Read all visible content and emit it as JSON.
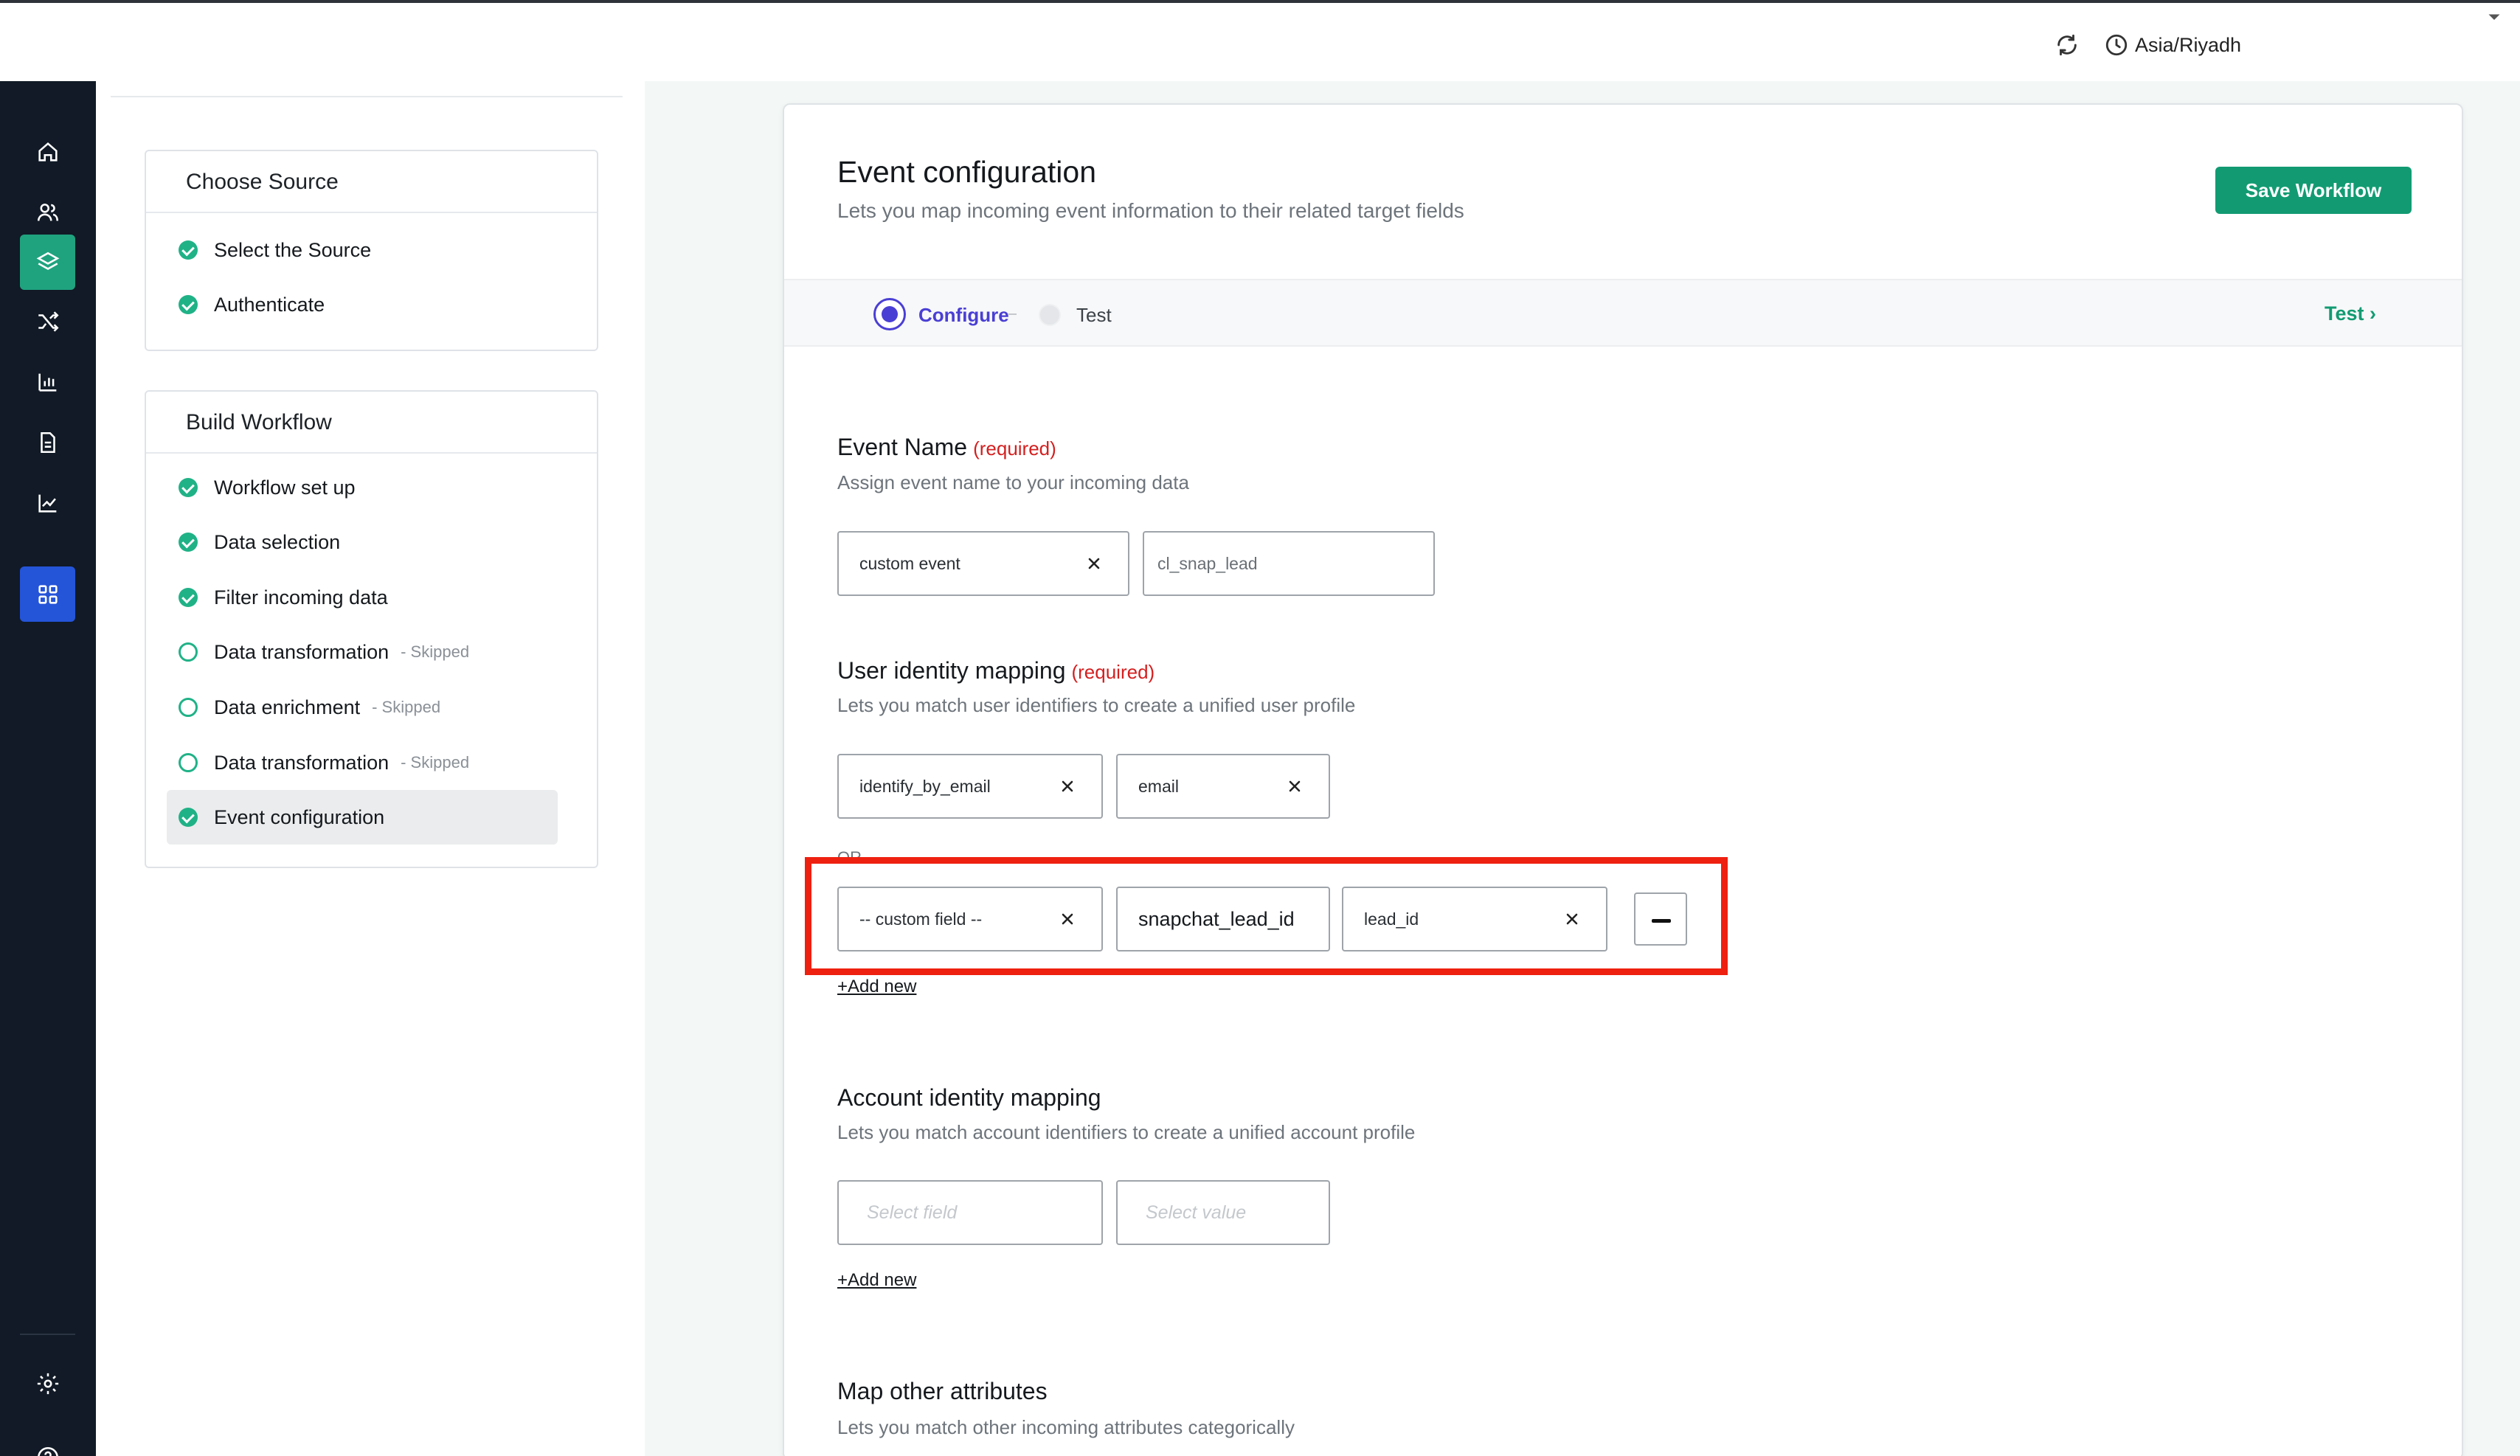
{
  "header": {
    "timezone": "Asia/Riyadh",
    "refresh_icon": "refresh-icon",
    "clock_icon": "clock-icon"
  },
  "rail": {
    "items": [
      {
        "icon": "home-icon"
      },
      {
        "icon": "users-icon"
      },
      {
        "icon": "layers-icon",
        "active": true,
        "color": "#1fa37f"
      },
      {
        "icon": "shuffle-icon"
      },
      {
        "icon": "bar-chart-icon"
      },
      {
        "icon": "document-icon"
      },
      {
        "icon": "line-chart-icon"
      },
      {
        "icon": "apps-grid-icon",
        "active": true,
        "color": "#2454d8"
      },
      {
        "icon": "gear-icon"
      },
      {
        "icon": "help-icon"
      }
    ]
  },
  "steps": {
    "choose_source": {
      "title": "Choose Source",
      "items": [
        {
          "label": "Select the Source",
          "status": "done"
        },
        {
          "label": "Authenticate",
          "status": "done"
        }
      ]
    },
    "build_workflow": {
      "title": "Build Workflow",
      "items": [
        {
          "label": "Workflow set up",
          "status": "done"
        },
        {
          "label": "Data selection",
          "status": "done"
        },
        {
          "label": "Filter incoming data",
          "status": "done"
        },
        {
          "label": "Data transformation",
          "status": "skipped",
          "note": "- Skipped"
        },
        {
          "label": "Data enrichment",
          "status": "skipped",
          "note": "- Skipped"
        },
        {
          "label": "Data transformation",
          "status": "skipped",
          "note": "- Skipped"
        },
        {
          "label": "Event configuration",
          "status": "done",
          "selected": true
        }
      ]
    }
  },
  "main": {
    "title": "Event configuration",
    "subtitle": "Lets you map incoming event information to their related target fields",
    "save_label": "Save Workflow",
    "stepper": {
      "configure_label": "Configure",
      "test_label": "Test",
      "test_link": "Test ›"
    },
    "event_name": {
      "title": "Event Name",
      "required": "(required)",
      "subtitle": "Assign event name to your incoming data",
      "type_value": "custom event",
      "name_value": "cl_snap_lead"
    },
    "user_identity": {
      "title": "User identity mapping",
      "required": "(required)",
      "subtitle": "Lets you match user identifiers to create a unified user profile",
      "row1": {
        "field": "identify_by_email",
        "value": "email"
      },
      "or_label": "OR",
      "row2": {
        "field": "-- custom field --",
        "custom_name": "snapchat_lead_id",
        "value": "lead_id"
      },
      "add_new": "+Add new"
    },
    "account_identity": {
      "title": "Account identity mapping",
      "subtitle": "Lets you match account identifiers to create a unified account profile",
      "field_placeholder": "Select field",
      "value_placeholder": "Select value",
      "add_new": "+Add new"
    },
    "other_attributes": {
      "title": "Map other attributes",
      "subtitle": "Lets you match other incoming attributes categorically"
    }
  },
  "colors": {
    "accent_green": "#129b72",
    "step_done": "#20b287",
    "configure_purple": "#4a3fd4",
    "required_red": "#d41f1f",
    "highlight_red": "#ee2010",
    "rail_bg": "#111a26"
  }
}
